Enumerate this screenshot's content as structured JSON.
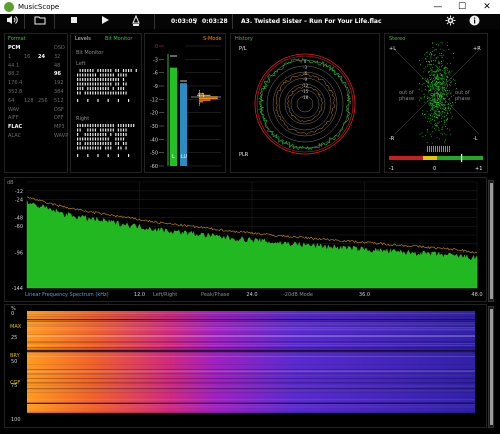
{
  "window": {
    "title": "MusicScope",
    "minimize": "—",
    "maximize": "☐",
    "close": "✕"
  },
  "toolbar": {
    "time_current": "0:03:05",
    "time_separator": "/",
    "time_total": "0:03:28",
    "track": "A3. Twisted Sister – Run For Your Life.flac",
    "icons": [
      "volume-icon",
      "folder-icon",
      "stop-icon",
      "play-icon",
      "loudness-icon",
      "settings-icon",
      "info-icon"
    ]
  },
  "format": {
    "title": "Format",
    "rows": [
      [
        "PCM",
        "",
        "",
        "DSD"
      ],
      [
        "1",
        "16",
        "24",
        "32"
      ],
      [
        "44.1",
        "",
        "",
        "48"
      ],
      [
        "88.2",
        "",
        "",
        "96"
      ],
      [
        "176.4",
        "",
        "",
        "192"
      ],
      [
        "352.8",
        "",
        "",
        "384"
      ],
      [
        "64",
        "128",
        "256",
        "512"
      ],
      [
        "WAV",
        "",
        "",
        "DSF"
      ],
      [
        "AIFF",
        "",
        "",
        "DFF"
      ],
      [
        "FLAC",
        "",
        "",
        "MP3"
      ],
      [
        "ALAC",
        "",
        "",
        "WAVP"
      ]
    ],
    "highlighted": [
      "PCM",
      "24",
      "96",
      "FLAC"
    ]
  },
  "levels": {
    "title": "Levels",
    "mode": "Bit Monitor",
    "sub": "Bit Monitor",
    "left": "Left",
    "right": "Right"
  },
  "meter": {
    "title": "S-Mode",
    "scale": [
      "0",
      "-3",
      "-6",
      "-9",
      "-12",
      "-20",
      "-30",
      "-40",
      "-50",
      "-60"
    ],
    "left_level": 0.82,
    "right_level": 0.69,
    "peak_label": "4.1",
    "channel_labels": [
      "L",
      "LU"
    ]
  },
  "history": {
    "title": "History",
    "pl_label": "P/L",
    "plr_label": "PLR"
  },
  "stereo": {
    "title": "Stereo",
    "plus_l": "+L",
    "plus_r": "+R",
    "minus_l": "-R",
    "minus_r": "-L",
    "out_of_phase_left": "out of\nphase",
    "out_of_phase_right": "out of\nphase",
    "corr_min": "-1",
    "corr_mid": "0",
    "corr_max": "+1"
  },
  "spectrum": {
    "y_unit": "dB",
    "y_ticks": [
      "0",
      "-12",
      "-24",
      "-36",
      "-48",
      "-60",
      "-72",
      "-84",
      "-96",
      "-108",
      "-120",
      "-132",
      "-144"
    ],
    "y_ticks_shown": [
      "-12",
      "-24",
      "-48",
      "-60",
      "-96",
      "-144"
    ],
    "x_ticks": [
      "12.0",
      "24.0",
      "36.0",
      "48.0"
    ],
    "label": "Linear Frequency Spectrum (kHz)",
    "modes": [
      "Left/Right",
      "Peak/Phase",
      "-20dB Mode"
    ]
  },
  "spectrogram": {
    "y_ticks": [
      "%",
      "0",
      "25",
      "50",
      "75",
      "100"
    ],
    "side_labels": [
      "MAX",
      "BRY",
      "CGF"
    ]
  },
  "chart_data": {
    "type": "area",
    "title": "",
    "xlabel": "Linear Frequency Spectrum (kHz)",
    "ylabel": "dB",
    "xlim": [
      0,
      48
    ],
    "ylim": [
      -144,
      0
    ],
    "x": [
      0,
      2,
      4,
      6,
      8,
      10,
      12,
      14,
      16,
      18,
      20,
      22,
      24,
      26,
      28,
      30,
      32,
      34,
      36,
      38,
      40,
      42,
      44,
      46,
      48
    ],
    "series": [
      {
        "name": "",
        "values": [
          -28,
          -36,
          -44,
          -49,
          -53,
          -57,
          -61,
          -65,
          -68,
          -71,
          -74,
          -77,
          -79,
          -82,
          -84,
          -86,
          -88,
          -90,
          -92,
          -94,
          -96,
          -97,
          -99,
          -101,
          -104
        ]
      },
      {
        "name": "",
        "values": [
          -20,
          -28,
          -34,
          -39,
          -43,
          -47,
          -51,
          -55,
          -58,
          -61,
          -64,
          -67,
          -69,
          -72,
          -74,
          -76,
          -78,
          -80,
          -82,
          -84,
          -86,
          -88,
          -90,
          -92,
          -96
        ]
      }
    ]
  }
}
